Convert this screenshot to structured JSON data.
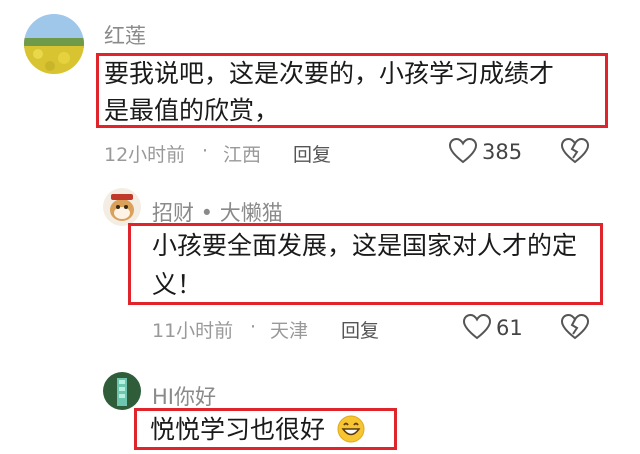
{
  "comments": [
    {
      "username": "红莲",
      "text_lines": [
        "要我说吧，这是次要的，小孩学习成绩才",
        "是最值的欣赏，"
      ],
      "time": "12小时前",
      "separator": "·",
      "location": "江西",
      "reply_label": "回复",
      "like_count": "385"
    },
    {
      "username": "招财 • 大懒猫",
      "text_lines": [
        "小孩要全面发展，这是国家对人才的定",
        "义！"
      ],
      "time": "11小时前",
      "separator": "·",
      "location": "天津",
      "reply_label": "回复",
      "like_count": "61"
    },
    {
      "username": "HI你好",
      "text_lines": [
        "悦悦学习也很好"
      ],
      "emoji": "grinning-face"
    }
  ],
  "colors": {
    "highlight": "#e0242b",
    "meta_text": "#999999",
    "username": "#8a8a8a"
  },
  "icons": [
    "heart-icon",
    "broken-heart-icon",
    "emoji-grin-icon"
  ]
}
